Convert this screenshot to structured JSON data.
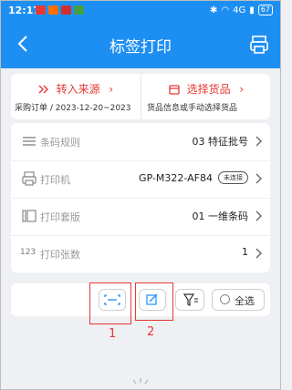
{
  "status_bar": {
    "time": "12:17",
    "network": "4G",
    "battery": "67",
    "app_colors": [
      "#e53935",
      "#ff6f00",
      "#d32f2f",
      "#43a047"
    ]
  },
  "header": {
    "title": "标签打印",
    "back_icon": "chevron-left-icon",
    "printer_icon": "printer-icon"
  },
  "source_card": {
    "transfer_label": "转入来源",
    "transfer_subtitle": "采购订单 / 2023-12-20~2023",
    "select_label": "选择货品",
    "select_subtitle": "货品信息或手动选择货品",
    "accent_color": "#e53935"
  },
  "settings": [
    {
      "label": "条码规则",
      "value": "03  特征批号",
      "icon": "barcode-rule-icon"
    },
    {
      "label": "打印机",
      "value": "GP-M322-AF84",
      "status": "未连接",
      "icon": "printer-icon"
    },
    {
      "label": "打印套版",
      "value": "01  一维条码",
      "icon": "template-icon"
    },
    {
      "label": "打印张数",
      "value": "1",
      "icon": "count-icon"
    }
  ],
  "toolbar": {
    "select_all_label": "全选",
    "scan_icon": "scan-icon",
    "edit_icon": "edit-icon",
    "filter_icon": "filter-icon"
  },
  "annotations": {
    "mark_1": "1",
    "mark_2": "2"
  },
  "theme": {
    "primary": "#1e8ff2",
    "annotation": "#e53935"
  }
}
